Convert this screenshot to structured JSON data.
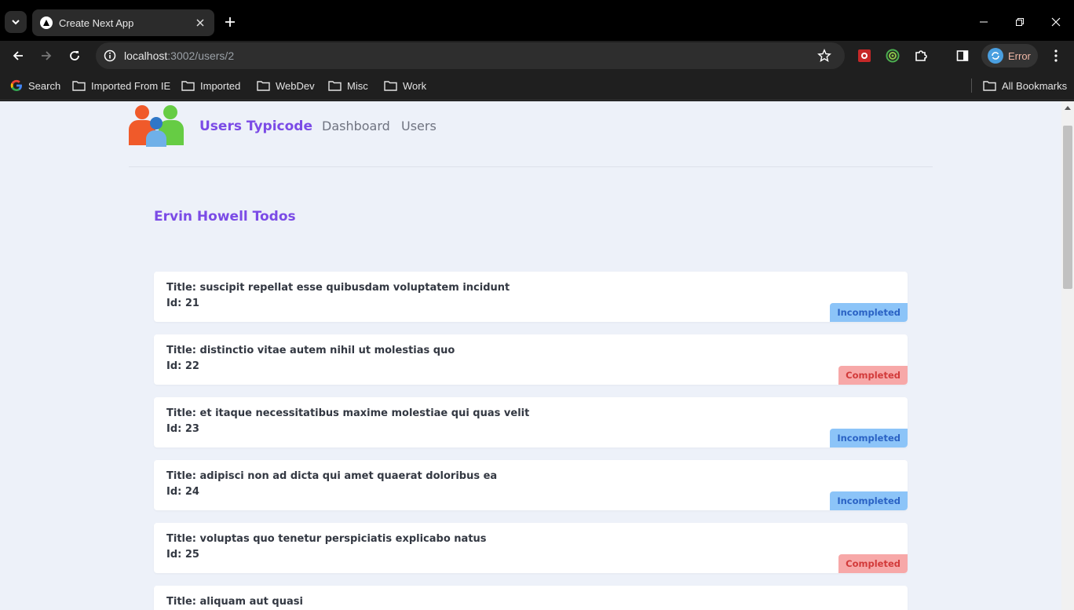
{
  "browser": {
    "tab_title": "Create Next App",
    "url_host": "localhost",
    "url_path": ":3002/users/2",
    "profile_label": "Error",
    "bookmarks": [
      "Search",
      "Imported From IE",
      "Imported",
      "WebDev",
      "Misc",
      "Work"
    ],
    "all_bookmarks_label": "All Bookmarks"
  },
  "site": {
    "brand": "Users Typicode",
    "nav": [
      "Dashboard",
      "Users"
    ]
  },
  "heading": "Ervin Howell Todos",
  "todos": [
    {
      "title": "Title: suscipit repellat esse quibusdam voluptatem incidunt",
      "id": "Id: 21",
      "status": "Incompleted"
    },
    {
      "title": "Title: distinctio vitae autem nihil ut molestias quo",
      "id": "Id: 22",
      "status": "Completed"
    },
    {
      "title": "Title: et itaque necessitatibus maxime molestiae qui quas velit",
      "id": "Id: 23",
      "status": "Incompleted"
    },
    {
      "title": "Title: adipisci non ad dicta qui amet quaerat doloribus ea",
      "id": "Id: 24",
      "status": "Incompleted"
    },
    {
      "title": "Title: voluptas quo tenetur perspiciatis explicabo natus",
      "id": "Id: 25",
      "status": "Completed"
    },
    {
      "title": "Title: aliquam aut quasi"
    }
  ],
  "colors": {
    "brand": "#7b4be6",
    "incomplete_bg": "#8cc4f8",
    "complete_bg": "#f7a8a8"
  }
}
